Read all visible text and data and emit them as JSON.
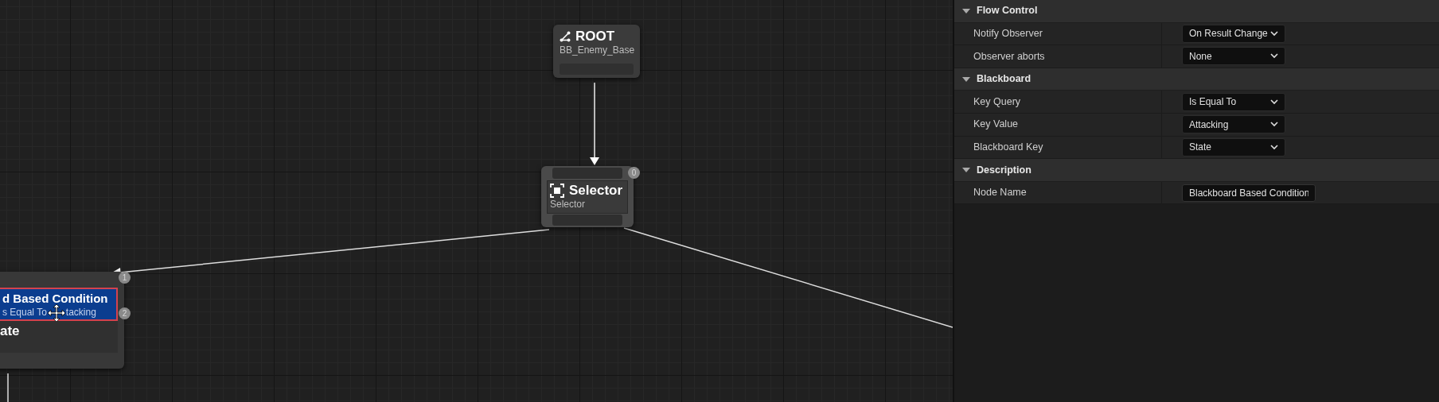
{
  "graph": {
    "nodes": [
      {
        "kind": "root",
        "title": "ROOT",
        "subtitle": "BB_Enemy_Base"
      },
      {
        "kind": "composite",
        "title": "Selector",
        "subtitle": "Selector",
        "index": "0"
      },
      {
        "kind": "task",
        "title": "d Based Condition",
        "subtitle": "s Equal To",
        "subtitle_end": "tacking",
        "body": "ate",
        "badges": [
          "1",
          "2"
        ],
        "selected": true
      }
    ]
  },
  "details": {
    "categories": [
      {
        "title": "Flow Control",
        "expanded": true,
        "properties": [
          {
            "label": "Notify Observer",
            "kind": "dropdown",
            "value": "On Result Change"
          },
          {
            "label": "Observer aborts",
            "kind": "dropdown",
            "value": "None"
          }
        ]
      },
      {
        "title": "Blackboard",
        "expanded": true,
        "properties": [
          {
            "label": "Key Query",
            "kind": "dropdown",
            "value": "Is Equal To"
          },
          {
            "label": "Key Value",
            "kind": "dropdown",
            "value": "Attacking"
          },
          {
            "label": "Blackboard Key",
            "kind": "dropdown",
            "value": "State"
          }
        ]
      },
      {
        "title": "Description",
        "expanded": true,
        "properties": [
          {
            "label": "Node Name",
            "kind": "text",
            "value": "Blackboard Based Condition"
          }
        ]
      }
    ]
  }
}
